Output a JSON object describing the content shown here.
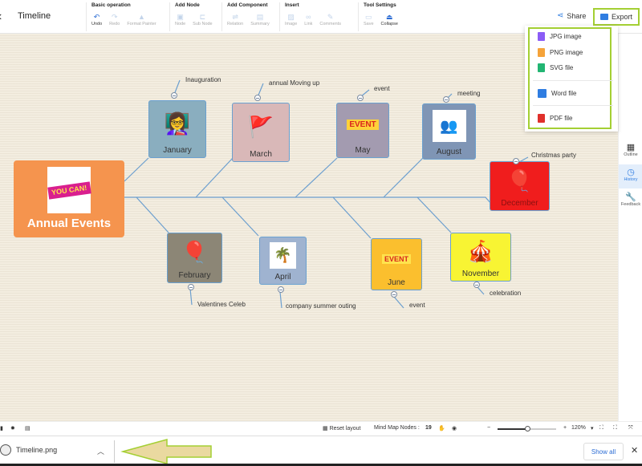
{
  "app": {
    "title": "Timeline"
  },
  "toolbar": {
    "groups": [
      {
        "title": "Basic operation",
        "tools": [
          {
            "label": "Undo",
            "icon": "undo-icon",
            "active": true
          },
          {
            "label": "Redo",
            "icon": "redo-icon",
            "active": false
          },
          {
            "label": "Format Painter",
            "icon": "format-painter-icon",
            "active": false
          }
        ]
      },
      {
        "title": "Add Node",
        "tools": [
          {
            "label": "Node",
            "icon": "node-icon",
            "active": false
          },
          {
            "label": "Sub Node",
            "icon": "sub-node-icon",
            "active": false
          }
        ]
      },
      {
        "title": "Add Component",
        "tools": [
          {
            "label": "Relation",
            "icon": "relation-icon",
            "active": false
          },
          {
            "label": "Summary",
            "icon": "summary-icon",
            "active": false
          }
        ]
      },
      {
        "title": "Insert",
        "tools": [
          {
            "label": "Image",
            "icon": "image-icon",
            "active": false
          },
          {
            "label": "Link",
            "icon": "link-icon",
            "active": false
          },
          {
            "label": "Comments",
            "icon": "comments-icon",
            "active": false
          }
        ]
      },
      {
        "title": "Tool Settings",
        "tools": [
          {
            "label": "Save",
            "icon": "save-icon",
            "active": false
          },
          {
            "label": "Collapse",
            "icon": "collapse-icon",
            "active": true
          }
        ]
      }
    ],
    "share_label": "Share",
    "export_label": "Export"
  },
  "export_menu": {
    "items": [
      {
        "label": "JPG image",
        "color": "#8b5cf6"
      },
      {
        "label": "PNG image",
        "color": "#f5a33a"
      },
      {
        "label": "SVG file",
        "color": "#22b573"
      },
      {
        "label": "Word file",
        "color": "#2f7de1"
      },
      {
        "label": "PDF file",
        "color": "#e0302b"
      }
    ]
  },
  "sidebar": {
    "items": [
      {
        "label": "Outline",
        "icon": "outline-icon",
        "active": false
      },
      {
        "label": "History",
        "icon": "history-icon",
        "active": true
      },
      {
        "label": "Feedback",
        "icon": "feedback-icon",
        "active": false
      }
    ]
  },
  "mindmap": {
    "root": {
      "label": "Annual Events",
      "image_text": "YOU CAN!"
    },
    "nodes": [
      {
        "label": "January",
        "note": "Inauguration",
        "color": "#8aaebf",
        "icon": "presenter-icon",
        "glyph": "👩‍🏫"
      },
      {
        "label": "March",
        "note": "annual Moving up",
        "color": "#d9b8b8",
        "icon": "climb-flag-icon",
        "glyph": "🚩"
      },
      {
        "label": "May",
        "note": "event",
        "color": "#a39bb0",
        "icon": "event-banner-icon",
        "glyph": "EVENT"
      },
      {
        "label": "August",
        "note": "meeting",
        "color": "#7f95b5",
        "icon": "meeting-icon",
        "glyph": "👥"
      },
      {
        "label": "December",
        "note": "Christmas party",
        "color": "#f01d1d",
        "icon": "calendar-balloons-icon",
        "glyph": "🎈"
      },
      {
        "label": "February",
        "note": "Valentines Celeb",
        "color": "#8c8676",
        "icon": "calendar-balloons-icon",
        "glyph": "🎈"
      },
      {
        "label": "April",
        "note": "company summer outing",
        "color": "#9fb3d0",
        "icon": "map-icon",
        "glyph": "🌴"
      },
      {
        "label": "June",
        "note": "event",
        "color": "#fbbf2e",
        "icon": "event-banner-icon",
        "glyph": "EVENT"
      },
      {
        "label": "November",
        "note": "celebration",
        "color": "#f8f433",
        "icon": "stage-icon",
        "glyph": "🎪"
      }
    ]
  },
  "statusbar": {
    "reset_layout": "Reset layout",
    "nodes_label": "Mind Map Nodes :",
    "nodes_count": "19",
    "zoom": "120%",
    "zoom_fraction": 0.5
  },
  "downloads": {
    "file_name": "Timeline.png",
    "show_all": "Show all"
  }
}
